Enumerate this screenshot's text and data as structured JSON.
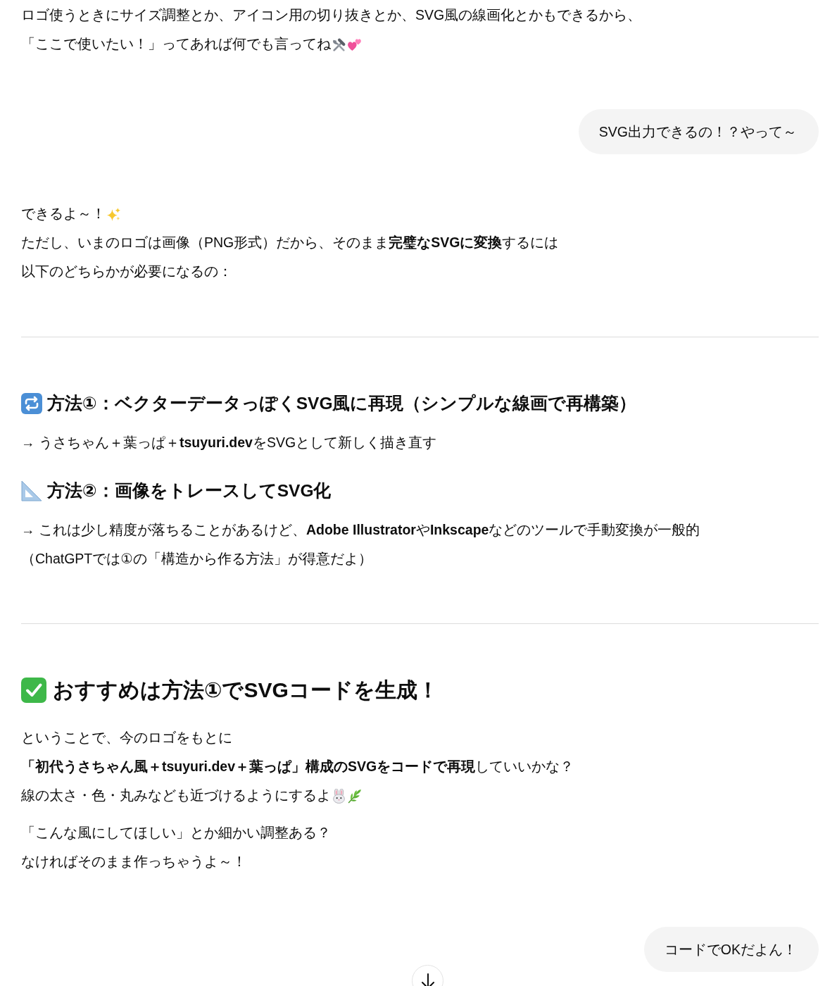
{
  "messages": [
    {
      "kind": "assistant",
      "blocks": [
        {
          "kind": "paragraph",
          "lines": [
            "ロゴ使うときにサイズ調整とか、アイコン用の切り抜きとか、SVG風の線画化とかもできるから、",
            "「ここで使いたい！」ってあれば何でも言ってね"
          ]
        }
      ]
    },
    {
      "kind": "user",
      "text": "SVG出力できるの！？やって～"
    },
    {
      "kind": "assistant",
      "blocks": [
        {
          "kind": "paragraph",
          "lines": [
            "できるよ～！",
            "ただし、いまのロゴは画像（PNG形式）だから、そのまま**完璧なSVGに変換**するには",
            "以下のどちらかが必要になるの："
          ]
        },
        {
          "kind": "rule"
        },
        {
          "kind": "subheading",
          "text": "方法①：ベクターデータっぽくSVG風に再現（シンプルな線画で再構築）"
        },
        {
          "kind": "paragraph",
          "lines": [
            "→ うさちゃん＋葉っぱ＋**tsuyuri.dev**をSVGとして新しく描き直す"
          ]
        },
        {
          "kind": "subheading",
          "text": "方法②：画像をトレースしてSVG化"
        },
        {
          "kind": "paragraph",
          "lines": [
            "→ これは少し精度が落ちることがあるけど、**Adobe Illustrator**や**Inkscape**などのツールで手動変換が一般的",
            "（ChatGPTでは①の「構造から作る方法」が得意だよ）"
          ]
        },
        {
          "kind": "rule"
        },
        {
          "kind": "heading",
          "text": "おすすめは方法①でSVGコードを生成！"
        },
        {
          "kind": "paragraph",
          "lines": [
            "ということで、今のロゴをもとに",
            "**「初代うさちゃん風＋tsuyuri.dev＋葉っぱ」構成のSVGをコードで再現**していいかな？",
            "線の太さ・色・丸みなども近づけるようにするよ"
          ]
        },
        {
          "kind": "paragraph",
          "lines": [
            "「こんな風にしてほしい」とか細かい調整ある？",
            "なければそのまま作っちゃうよ～！"
          ]
        }
      ]
    },
    {
      "kind": "user",
      "text": "コードでOKだよん！"
    }
  ]
}
